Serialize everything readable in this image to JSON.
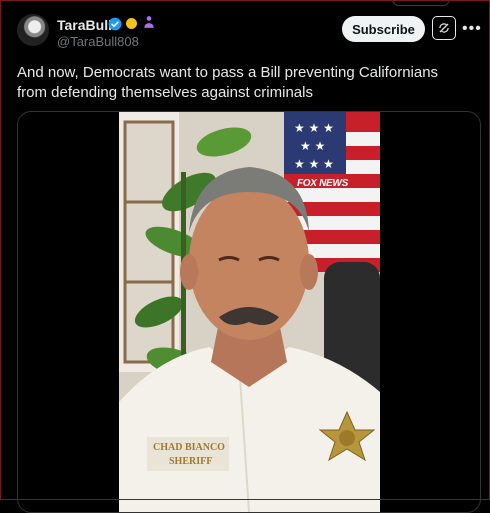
{
  "header": {
    "name": "TaraBull",
    "handle": "@TaraBull808",
    "subscribe_label": "Subscribe"
  },
  "tweet": {
    "text": "And now, Democrats want to pass a Bill preventing Californians from defending themselves against criminals"
  },
  "video": {
    "watermark": "FOX NEWS",
    "name_tag": "CHAD BIANCO",
    "title_tag": "SHERIFF"
  },
  "icons": [
    "avatar",
    "verified-badge-icon",
    "gold-coin-icon",
    "people-icon",
    "grok-icon",
    "more-icon"
  ],
  "colors": {
    "accent": "#1d9bf0",
    "subscribe_bg": "#eff3f4",
    "text": "#e7e9ea",
    "muted": "#71767b"
  }
}
